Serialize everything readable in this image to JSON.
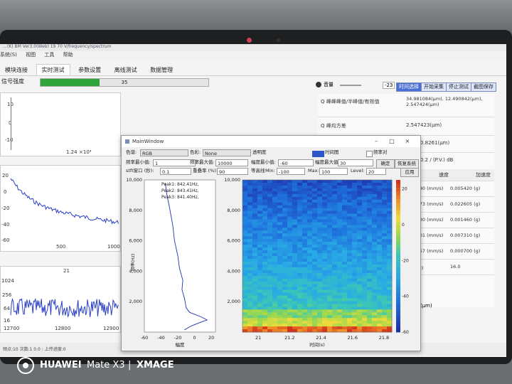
{
  "photo_overlay": {
    "brand": "HUAWEI",
    "model": "Mate X3",
    "separator": "|",
    "imaging": "XMAGE"
  },
  "main_window": {
    "title": "…(K) BM Ver3.0(Web) 19 70 V/frequency/spectrum",
    "menu": [
      "系统(S)",
      "视图",
      "工具",
      "帮助"
    ],
    "tabs": [
      "模块连接",
      "实时测试",
      "参数设置",
      "离线测试",
      "数据管理"
    ],
    "signal_strength_label": "信号强度",
    "progress_value": "35",
    "progress_fraction": 0.35,
    "volume_label": "音量",
    "volume_value": "-23",
    "right_buttons": [
      "时间选择",
      "开始采集",
      "停止测试",
      "截图保存"
    ],
    "info_rows": [
      {
        "label": "Q 峰峰峰值/半峰值/有效值",
        "value": "34.981084(μm), 12.490842(μm), 2.547424(μm)"
      },
      {
        "label": "Q 峰均方差",
        "value": "2.547423(μm)"
      },
      {
        "label": "",
        "value": "0.8261(μm)"
      },
      {
        "label": "",
        "value": "0.2 /  (P.V.)  dB"
      }
    ],
    "table_headers": [
      "速度",
      "加速度"
    ],
    "table_rows": [
      [
        "",
        "0.074690 (mm/s)",
        "0.005420 (g)"
      ],
      [
        "",
        "1.185373 (mm/s)",
        "0.022605 (g)"
      ],
      [
        "",
        "1.043130 (mm/s)",
        "0.001460 (g)"
      ],
      [
        "",
        "0.973201 (mm/s)",
        "0.007310 (g)"
      ],
      [
        "",
        "0.277057 (mm/s)",
        "0.000700 (g)"
      ],
      [
        "",
        "有效 (Hz)",
        "16.0"
      ]
    ],
    "um_label": "(μm)",
    "status_bar": "频点:10 次数:1 0.0 : 上传进度:0",
    "left_plots": {
      "top_ylabels": [
        "10",
        "0",
        "-10"
      ],
      "top_xlabel": "1.24",
      "top_exp": "×10⁴",
      "mid_ylabels": [
        "20",
        "0",
        "-20",
        "-40",
        "-60"
      ],
      "mid_xlabels": [
        "500",
        "1000"
      ],
      "bot_title": "21",
      "bot_ylabels": [
        "1024",
        "256",
        "64",
        "16"
      ],
      "bot_xlabels": [
        "12700",
        "12800",
        "12900"
      ]
    }
  },
  "dialog": {
    "title": "MainWindow",
    "controls": {
      "color_label": "色谱:",
      "color_value": "RGB",
      "color2_label": "色彩:",
      "color2_value": "None",
      "transparency_label": "透明度",
      "time_chart_label": "时间图",
      "freq_log_label": "频率对",
      "freq_min_label": "频率最小值:",
      "freq_min_value": "1",
      "freq_max_label": "频率最大值:",
      "freq_max_value": "10000",
      "amp_min_label": "幅度最小值:",
      "amp_min_value": "-60",
      "amp_max_label": "幅度最大值:",
      "amp_max_value": "30",
      "confirm_button": "确定",
      "reset_button": "恢复系统",
      "stft_label": "stft窗口 (秒):",
      "stft_value": "0.1",
      "overlap_label": "重叠率 (%):",
      "overlap_value": "90",
      "equal_label": "等高线",
      "min_label": "Min:",
      "min_value": "-100",
      "max_label": "Max:",
      "max_value": "100",
      "level_label": "Level:",
      "level_value": "20",
      "apply_button": "应用"
    },
    "spectrum_plot": {
      "peaks": [
        "Peak1: 842.41Hz,",
        "Peak2: 843.41Hz,",
        "Peak3: 841.40Hz,"
      ],
      "xlabel": "幅度"
    },
    "spectrogram": {
      "xlabel": "时间(s)",
      "ylabel": "频率(Hz)"
    }
  },
  "chart_data": {
    "type": "heatmap",
    "title": "",
    "xlabel": "时间(s)",
    "ylabel": "频率(Hz)",
    "x_ticks": [
      "21",
      "21.2",
      "21.4",
      "21.6",
      "21.8"
    ],
    "y_ticks": [
      "2,000",
      "4,000",
      "6,000",
      "8,000",
      "10,000"
    ],
    "xlim": [
      20.9,
      21.85
    ],
    "ylim": [
      0,
      10000
    ],
    "colorbar_ticks": [
      "20",
      "0",
      "-20",
      "-40",
      "-60"
    ],
    "colorbar_range": [
      -60,
      25
    ],
    "spectrum_line": {
      "xlim": [
        -60,
        25
      ],
      "x_ticks": [
        "-60",
        "-40",
        "-20",
        "0",
        "20"
      ],
      "y_ticks": [
        "2,000",
        "4,000",
        "6,000",
        "8,000",
        "10,000"
      ],
      "ylabel": "频率(Hz)",
      "points": [
        [
          -35,
          9800
        ],
        [
          -33,
          9000
        ],
        [
          -30,
          8200
        ],
        [
          -26,
          7000
        ],
        [
          -24,
          6000
        ],
        [
          -20,
          5000
        ],
        [
          -18,
          4200
        ],
        [
          -14,
          3400
        ],
        [
          -15,
          2800
        ],
        [
          -12,
          2200
        ],
        [
          -10,
          1600
        ],
        [
          -6,
          1300
        ],
        [
          8,
          1000
        ],
        [
          15,
          800
        ],
        [
          5,
          600
        ],
        [
          -4,
          400
        ],
        [
          -12,
          150
        ]
      ]
    }
  }
}
